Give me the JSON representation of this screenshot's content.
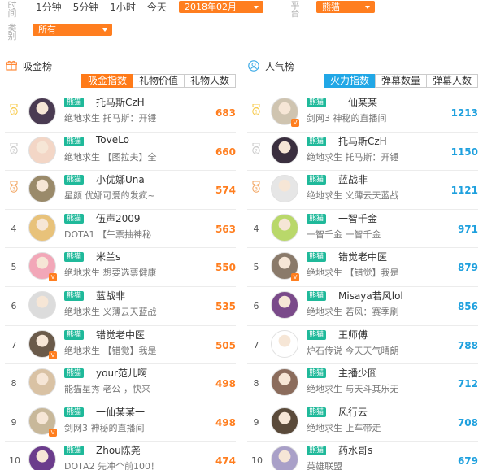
{
  "filters": {
    "time_label": "时间",
    "time_links": [
      "1分钟",
      "5分钟",
      "1小时",
      "今天"
    ],
    "month": "2018年02月",
    "platform_label": "平台",
    "platform": "熊猫",
    "category_label": "类别",
    "category": "所有"
  },
  "colors": {
    "accent_orange": "#ff7e1f",
    "accent_blue": "#1ea0de",
    "platform_badge": "#1fb99a"
  },
  "left": {
    "title": "吸金榜",
    "icon": "gift-icon",
    "tabs": [
      "吸金指数",
      "礼物价值",
      "礼物人数"
    ],
    "active_tab": 0,
    "rows": [
      {
        "rank": "1",
        "platform": "熊猫",
        "name": "托马斯CzH",
        "desc": "绝地求生 托马斯：开锤",
        "score": "683",
        "verified": false
      },
      {
        "rank": "2",
        "platform": "熊猫",
        "name": "ToveLo",
        "desc": "绝地求生 【图拉夫】全",
        "score": "660",
        "verified": false
      },
      {
        "rank": "3",
        "platform": "熊猫",
        "name": "小优娜Una",
        "desc": "星颜 优娜可爱的发疯~",
        "score": "574",
        "verified": false
      },
      {
        "rank": "4",
        "platform": "熊猫",
        "name": "伍声2009",
        "desc": "DOTA1 【午票抽神秘",
        "score": "563",
        "verified": false
      },
      {
        "rank": "5",
        "platform": "熊猫",
        "name": "米兰s",
        "desc": "绝地求生 想要选票健康",
        "score": "550",
        "verified": true
      },
      {
        "rank": "6",
        "platform": "熊猫",
        "name": "蓝战非",
        "desc": "绝地求生 义薄云天蓝战",
        "score": "535",
        "verified": false
      },
      {
        "rank": "7",
        "platform": "熊猫",
        "name": "错觉老中医",
        "desc": "绝地求生 【错觉】我是",
        "score": "505",
        "verified": true
      },
      {
        "rank": "8",
        "platform": "熊猫",
        "name": "your范儿啊",
        "desc": "能猫星秀 老公 ，快来",
        "score": "498",
        "verified": false
      },
      {
        "rank": "9",
        "platform": "熊猫",
        "name": "一仙某某一",
        "desc": "剑网3 神秘的直播间",
        "score": "498",
        "verified": true
      },
      {
        "rank": "10",
        "platform": "熊猫",
        "name": "Zhou陈尧",
        "desc": "DOTA2 先冲个前100！",
        "score": "474",
        "verified": false
      }
    ]
  },
  "right": {
    "title": "人气榜",
    "icon": "people-icon",
    "tabs": [
      "火力指数",
      "弹幕数量",
      "弹幕人数"
    ],
    "active_tab": 0,
    "rows": [
      {
        "rank": "1",
        "platform": "熊猫",
        "name": "一仙某某一",
        "desc": "剑网3 神秘的直播间",
        "score": "1213",
        "verified": true
      },
      {
        "rank": "2",
        "platform": "熊猫",
        "name": "托马斯CzH",
        "desc": "绝地求生 托马斯：开锤",
        "score": "1150",
        "verified": false
      },
      {
        "rank": "3",
        "platform": "熊猫",
        "name": "蓝战非",
        "desc": "绝地求生 义薄云天蓝战",
        "score": "1121",
        "verified": false
      },
      {
        "rank": "4",
        "platform": "熊猫",
        "name": "一智千金",
        "desc": "一智千金 一智千金",
        "score": "971",
        "verified": false
      },
      {
        "rank": "5",
        "platform": "熊猫",
        "name": "错觉老中医",
        "desc": "绝地求生 【错觉】我是",
        "score": "879",
        "verified": true
      },
      {
        "rank": "6",
        "platform": "熊猫",
        "name": "Misaya若风lol",
        "desc": "绝地求生 若风：赛季刷",
        "score": "856",
        "verified": false
      },
      {
        "rank": "7",
        "platform": "熊猫",
        "name": "王师傅",
        "desc": "炉石传说 今天天气晴朗",
        "score": "788",
        "verified": false
      },
      {
        "rank": "8",
        "platform": "熊猫",
        "name": "主播少囧",
        "desc": "绝地求生 与天斗其乐无",
        "score": "712",
        "verified": false
      },
      {
        "rank": "9",
        "platform": "熊猫",
        "name": "风行云",
        "desc": "绝地求生 上车带走",
        "score": "708",
        "verified": false
      },
      {
        "rank": "10",
        "platform": "熊猫",
        "name": "药水哥s",
        "desc": "英雄联盟",
        "score": "679",
        "verified": false
      }
    ]
  }
}
